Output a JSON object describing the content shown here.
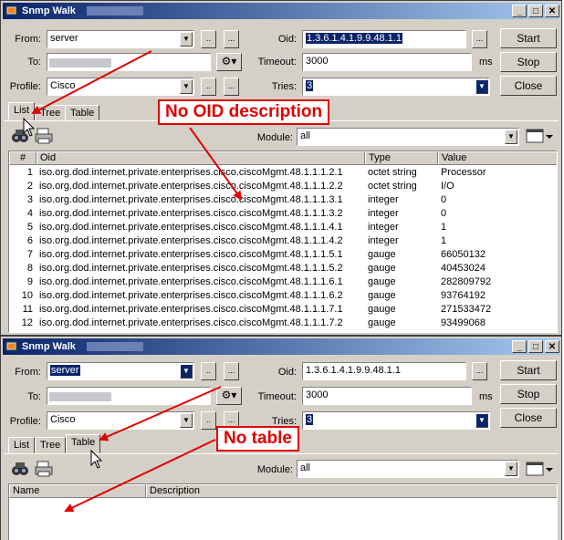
{
  "windows": [
    {
      "title": "Snmp Walk",
      "labels": {
        "from": "From:",
        "to": "To:",
        "profile": "Profile:",
        "oid": "Oid:",
        "timeout": "Timeout:",
        "tries": "Tries:",
        "module": "Module:",
        "ms": "ms"
      },
      "from_value": "server",
      "profile_value": "Cisco",
      "oid_value": "1.3.6.1.4.1.9.9.48.1.1",
      "timeout_value": "3000",
      "tries_value": "3",
      "module_value": "all",
      "small_buttons": {
        "dot": "..",
        "ellipsis": "..."
      },
      "buttons": {
        "start": "Start",
        "stop": "Stop",
        "close": "Close"
      },
      "tabs": [
        "List",
        "Tree",
        "Table"
      ],
      "active_tab": "List",
      "columns": {
        "num": "#",
        "oid": "Oid",
        "type": "Type",
        "value": "Value"
      },
      "rows": [
        {
          "n": "1",
          "oid": "iso.org.dod.internet.private.enterprises.cisco.ciscoMgmt.48.1.1.1.2.1",
          "type": "octet string",
          "value": "Processor"
        },
        {
          "n": "2",
          "oid": "iso.org.dod.internet.private.enterprises.cisco.ciscoMgmt.48.1.1.1.2.2",
          "type": "octet string",
          "value": "I/O"
        },
        {
          "n": "3",
          "oid": "iso.org.dod.internet.private.enterprises.cisco.ciscoMgmt.48.1.1.1.3.1",
          "type": "integer",
          "value": "0"
        },
        {
          "n": "4",
          "oid": "iso.org.dod.internet.private.enterprises.cisco.ciscoMgmt.48.1.1.1.3.2",
          "type": "integer",
          "value": "0"
        },
        {
          "n": "5",
          "oid": "iso.org.dod.internet.private.enterprises.cisco.ciscoMgmt.48.1.1.1.4.1",
          "type": "integer",
          "value": "1"
        },
        {
          "n": "6",
          "oid": "iso.org.dod.internet.private.enterprises.cisco.ciscoMgmt.48.1.1.1.4.2",
          "type": "integer",
          "value": "1"
        },
        {
          "n": "7",
          "oid": "iso.org.dod.internet.private.enterprises.cisco.ciscoMgmt.48.1.1.1.5.1",
          "type": "gauge",
          "value": "66050132"
        },
        {
          "n": "8",
          "oid": "iso.org.dod.internet.private.enterprises.cisco.ciscoMgmt.48.1.1.1.5.2",
          "type": "gauge",
          "value": "40453024"
        },
        {
          "n": "9",
          "oid": "iso.org.dod.internet.private.enterprises.cisco.ciscoMgmt.48.1.1.1.6.1",
          "type": "gauge",
          "value": "282809792"
        },
        {
          "n": "10",
          "oid": "iso.org.dod.internet.private.enterprises.cisco.ciscoMgmt.48.1.1.1.6.2",
          "type": "gauge",
          "value": "93764192"
        },
        {
          "n": "11",
          "oid": "iso.org.dod.internet.private.enterprises.cisco.ciscoMgmt.48.1.1.1.7.1",
          "type": "gauge",
          "value": "271533472"
        },
        {
          "n": "12",
          "oid": "iso.org.dod.internet.private.enterprises.cisco.ciscoMgmt.48.1.1.1.7.2",
          "type": "gauge",
          "value": "93499068"
        }
      ],
      "annotation": "No OID description"
    },
    {
      "title": "Snmp Walk",
      "labels": {
        "from": "From:",
        "to": "To:",
        "profile": "Profile:",
        "oid": "Oid:",
        "timeout": "Timeout:",
        "tries": "Tries:",
        "module": "Module:",
        "ms": "ms"
      },
      "from_value": "server",
      "profile_value": "Cisco",
      "oid_value": "1.3.6.1.4.1.9.9.48.1.1",
      "timeout_value": "3000",
      "tries_value": "3",
      "module_value": "all",
      "small_buttons": {
        "dot": "..",
        "ellipsis": "..."
      },
      "buttons": {
        "start": "Start",
        "stop": "Stop",
        "close": "Close"
      },
      "tabs": [
        "List",
        "Tree",
        "Table"
      ],
      "active_tab": "Table",
      "columns": {
        "name": "Name",
        "description": "Description"
      },
      "annotation": "No table"
    }
  ],
  "colors": {
    "titlebar_start": "#0a246a",
    "titlebar_end": "#a6caf0",
    "annotation": "#e00000",
    "face": "#d4d0c8"
  },
  "icons": [
    "window-icon",
    "minimize-icon",
    "maximize-icon",
    "close-icon",
    "profile-settings-icon",
    "find-icon",
    "print-icon",
    "columns-icon",
    "mouse-cursor-icon"
  ]
}
